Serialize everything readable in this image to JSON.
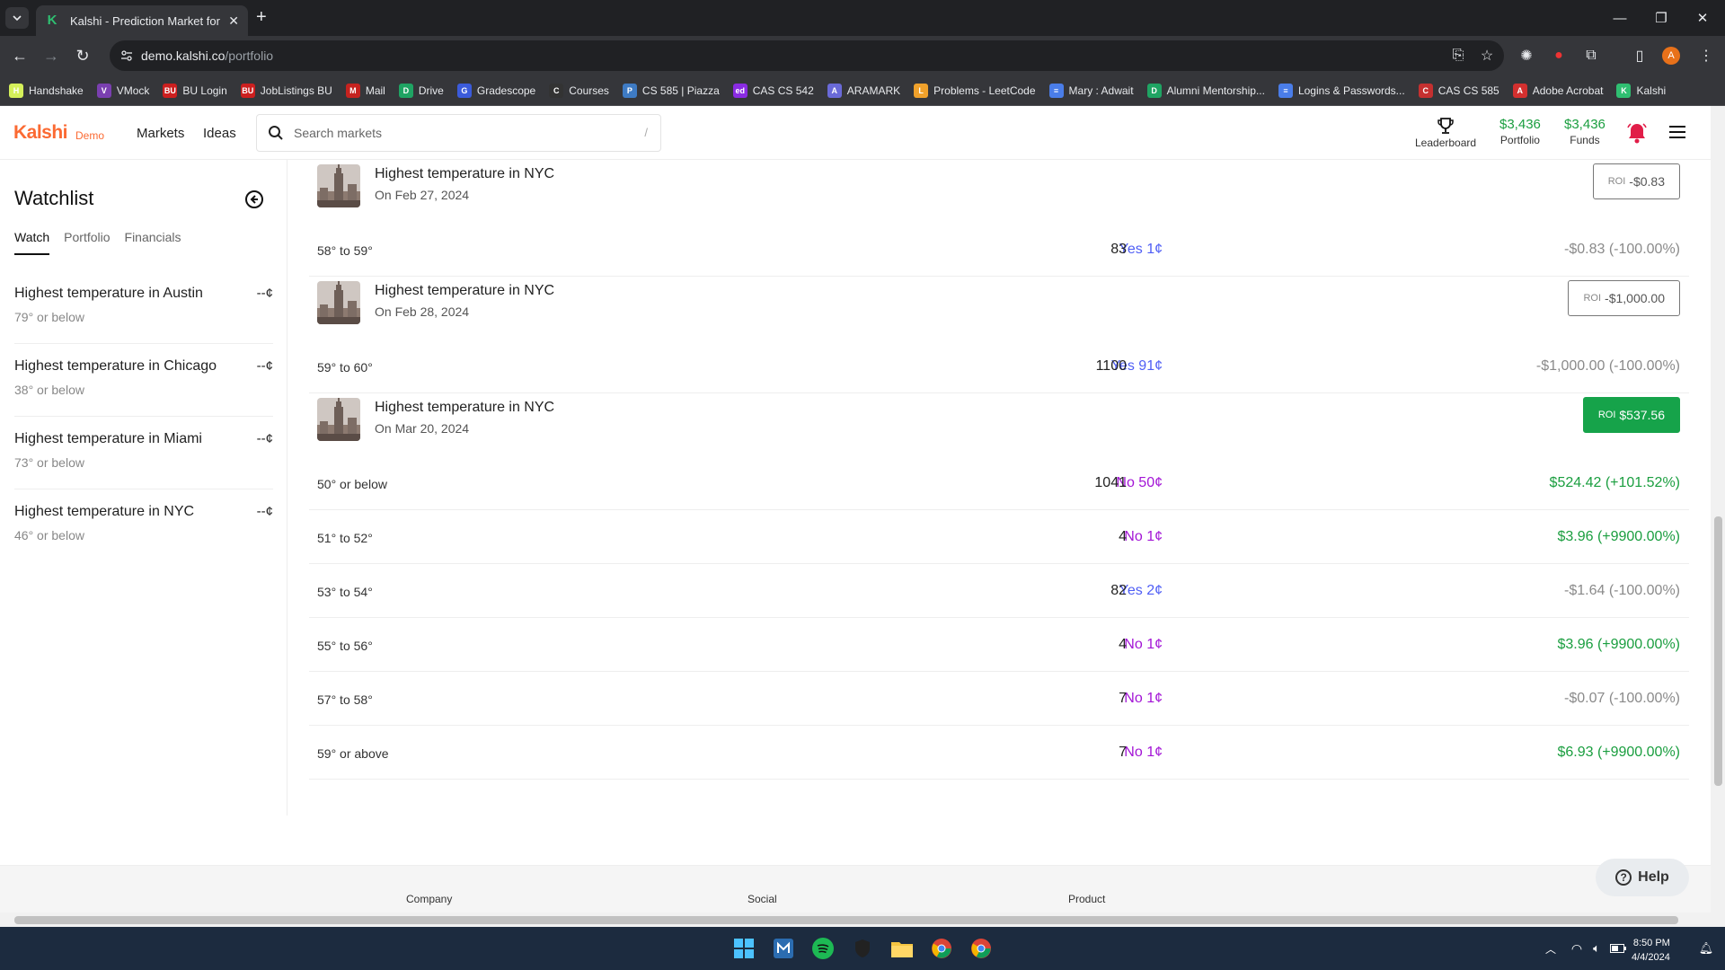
{
  "browser": {
    "tab_title": "Kalshi - Prediction Market for Tr",
    "url_host": "demo.kalshi.co",
    "url_path": "/portfolio",
    "bookmarks": [
      {
        "label": "Handshake",
        "icon": "H",
        "color": "#d5f05a"
      },
      {
        "label": "VMock",
        "icon": "V",
        "color": "#7a3fb0"
      },
      {
        "label": "BU Login",
        "icon": "BU",
        "color": "#cc1f1f"
      },
      {
        "label": "JobListings BU",
        "icon": "BU",
        "color": "#cc1f1f"
      },
      {
        "label": "Mail",
        "icon": "M",
        "color": "#c5221f"
      },
      {
        "label": "Drive",
        "icon": "D",
        "color": "#1fa463"
      },
      {
        "label": "Gradescope",
        "icon": "G",
        "color": "#3b5bdb"
      },
      {
        "label": "Courses",
        "icon": "C",
        "color": "#333333"
      },
      {
        "label": "CS 585 | Piazza",
        "icon": "P",
        "color": "#3e7bc4"
      },
      {
        "label": "CAS CS 542",
        "icon": "ed",
        "color": "#8a2be2"
      },
      {
        "label": "ARAMARK",
        "icon": "A",
        "color": "#6a6ad8"
      },
      {
        "label": "Problems - LeetCode",
        "icon": "L",
        "color": "#f0a12b"
      },
      {
        "label": "Mary : Adwait",
        "icon": "≡",
        "color": "#4a7de8"
      },
      {
        "label": "Alumni Mentorship...",
        "icon": "D",
        "color": "#1fa463"
      },
      {
        "label": "Logins & Passwords...",
        "icon": "≡",
        "color": "#4a7de8"
      },
      {
        "label": "CAS CS 585",
        "icon": "C",
        "color": "#c53030"
      },
      {
        "label": "Adobe Acrobat",
        "icon": "A",
        "color": "#d3302f"
      },
      {
        "label": "Kalshi",
        "icon": "K",
        "color": "#2fbf71"
      }
    ]
  },
  "header": {
    "logo": "Kalshi",
    "badge": "Demo",
    "nav": [
      "Markets",
      "Ideas"
    ],
    "search_placeholder": "Search markets",
    "search_shortcut": "/",
    "leaderboard": "Leaderboard",
    "portfolio_amount": "$3,436",
    "portfolio_label": "Portfolio",
    "funds_amount": "$3,436",
    "funds_label": "Funds"
  },
  "watchlist": {
    "title": "Watchlist",
    "tabs": [
      "Watch",
      "Portfolio",
      "Financials"
    ],
    "items": [
      {
        "name": "Highest temperature in Austin",
        "sub": "79° or below",
        "price": "--¢"
      },
      {
        "name": "Highest temperature in Chicago",
        "sub": "38° or below",
        "price": "--¢"
      },
      {
        "name": "Highest temperature in Miami",
        "sub": "73° or below",
        "price": "--¢"
      },
      {
        "name": "Highest temperature in NYC",
        "sub": "46° or below",
        "price": "--¢"
      }
    ]
  },
  "markets": [
    {
      "title": "Highest temperature in NYC",
      "date": "On Feb 27, 2024",
      "roi_label": "ROI",
      "roi_value": "-$0.83",
      "roi_positive": false,
      "rows": [
        {
          "range": "58° to 59°",
          "position": "Yes 1¢",
          "side": "yes",
          "qty": "83",
          "return": "-$0.83 (-100.00%)",
          "gain": false
        }
      ]
    },
    {
      "title": "Highest temperature in NYC",
      "date": "On Feb 28, 2024",
      "roi_label": "ROI",
      "roi_value": "-$1,000.00",
      "roi_positive": false,
      "rows": [
        {
          "range": "59° to 60°",
          "position": "Yes 91¢",
          "side": "yes",
          "qty": "1100",
          "return": "-$1,000.00 (-100.00%)",
          "gain": false
        }
      ]
    },
    {
      "title": "Highest temperature in NYC",
      "date": "On Mar 20, 2024",
      "roi_label": "ROI",
      "roi_value": "$537.56",
      "roi_positive": true,
      "rows": [
        {
          "range": "50° or below",
          "position": "No 50¢",
          "side": "no",
          "qty": "1041",
          "return": "$524.42 (+101.52%)",
          "gain": true
        },
        {
          "range": "51° to 52°",
          "position": "No 1¢",
          "side": "no",
          "qty": "4",
          "return": "$3.96 (+9900.00%)",
          "gain": true
        },
        {
          "range": "53° to 54°",
          "position": "Yes 2¢",
          "side": "yes",
          "qty": "82",
          "return": "-$1.64 (-100.00%)",
          "gain": false
        },
        {
          "range": "55° to 56°",
          "position": "No 1¢",
          "side": "no",
          "qty": "4",
          "return": "$3.96 (+9900.00%)",
          "gain": true
        },
        {
          "range": "57° to 58°",
          "position": "No 1¢",
          "side": "no",
          "qty": "7",
          "return": "-$0.07 (-100.00%)",
          "gain": false
        },
        {
          "range": "59° or above",
          "position": "No 1¢",
          "side": "no",
          "qty": "7",
          "return": "$6.93 (+9900.00%)",
          "gain": true
        }
      ]
    }
  ],
  "footer": {
    "columns": [
      "Company",
      "Social",
      "Product"
    ],
    "help": "Help"
  },
  "taskbar": {
    "time": "8:50 PM",
    "date": "4/4/2024"
  },
  "colors": {
    "brand": "#fb6a33",
    "gain": "#1a9e3f",
    "yes": "#4f5ef5",
    "no": "#a315d6",
    "roi_positive_bg": "#16a34a"
  }
}
